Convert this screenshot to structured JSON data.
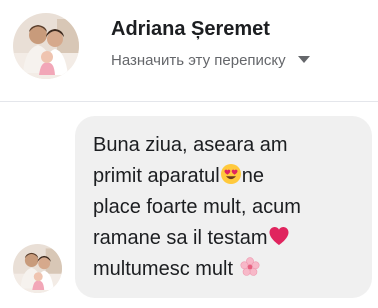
{
  "conversation": {
    "contact_name": "Adriana Șeremet",
    "assign_label": "Назначить эту переписку"
  },
  "message": {
    "line1": "Buna ziua, aseara am",
    "line2_before": "primit aparatul",
    "line2_emoji": "smiling-face-with-heart-eyes-icon",
    "line2_after": "ne",
    "line3": "place foarte mult, acum",
    "line4": "ramane sa il testam",
    "line4_emoji": "red-heart-icon",
    "line5": "multumesc mult",
    "line5_emoji": "cherry-blossom-icon"
  },
  "colors": {
    "bubble": "#f0f0f0",
    "text": "#1c1e21",
    "secondary_text": "#65676b",
    "divider": "#e4e6eb",
    "heart": "#e0245e"
  }
}
